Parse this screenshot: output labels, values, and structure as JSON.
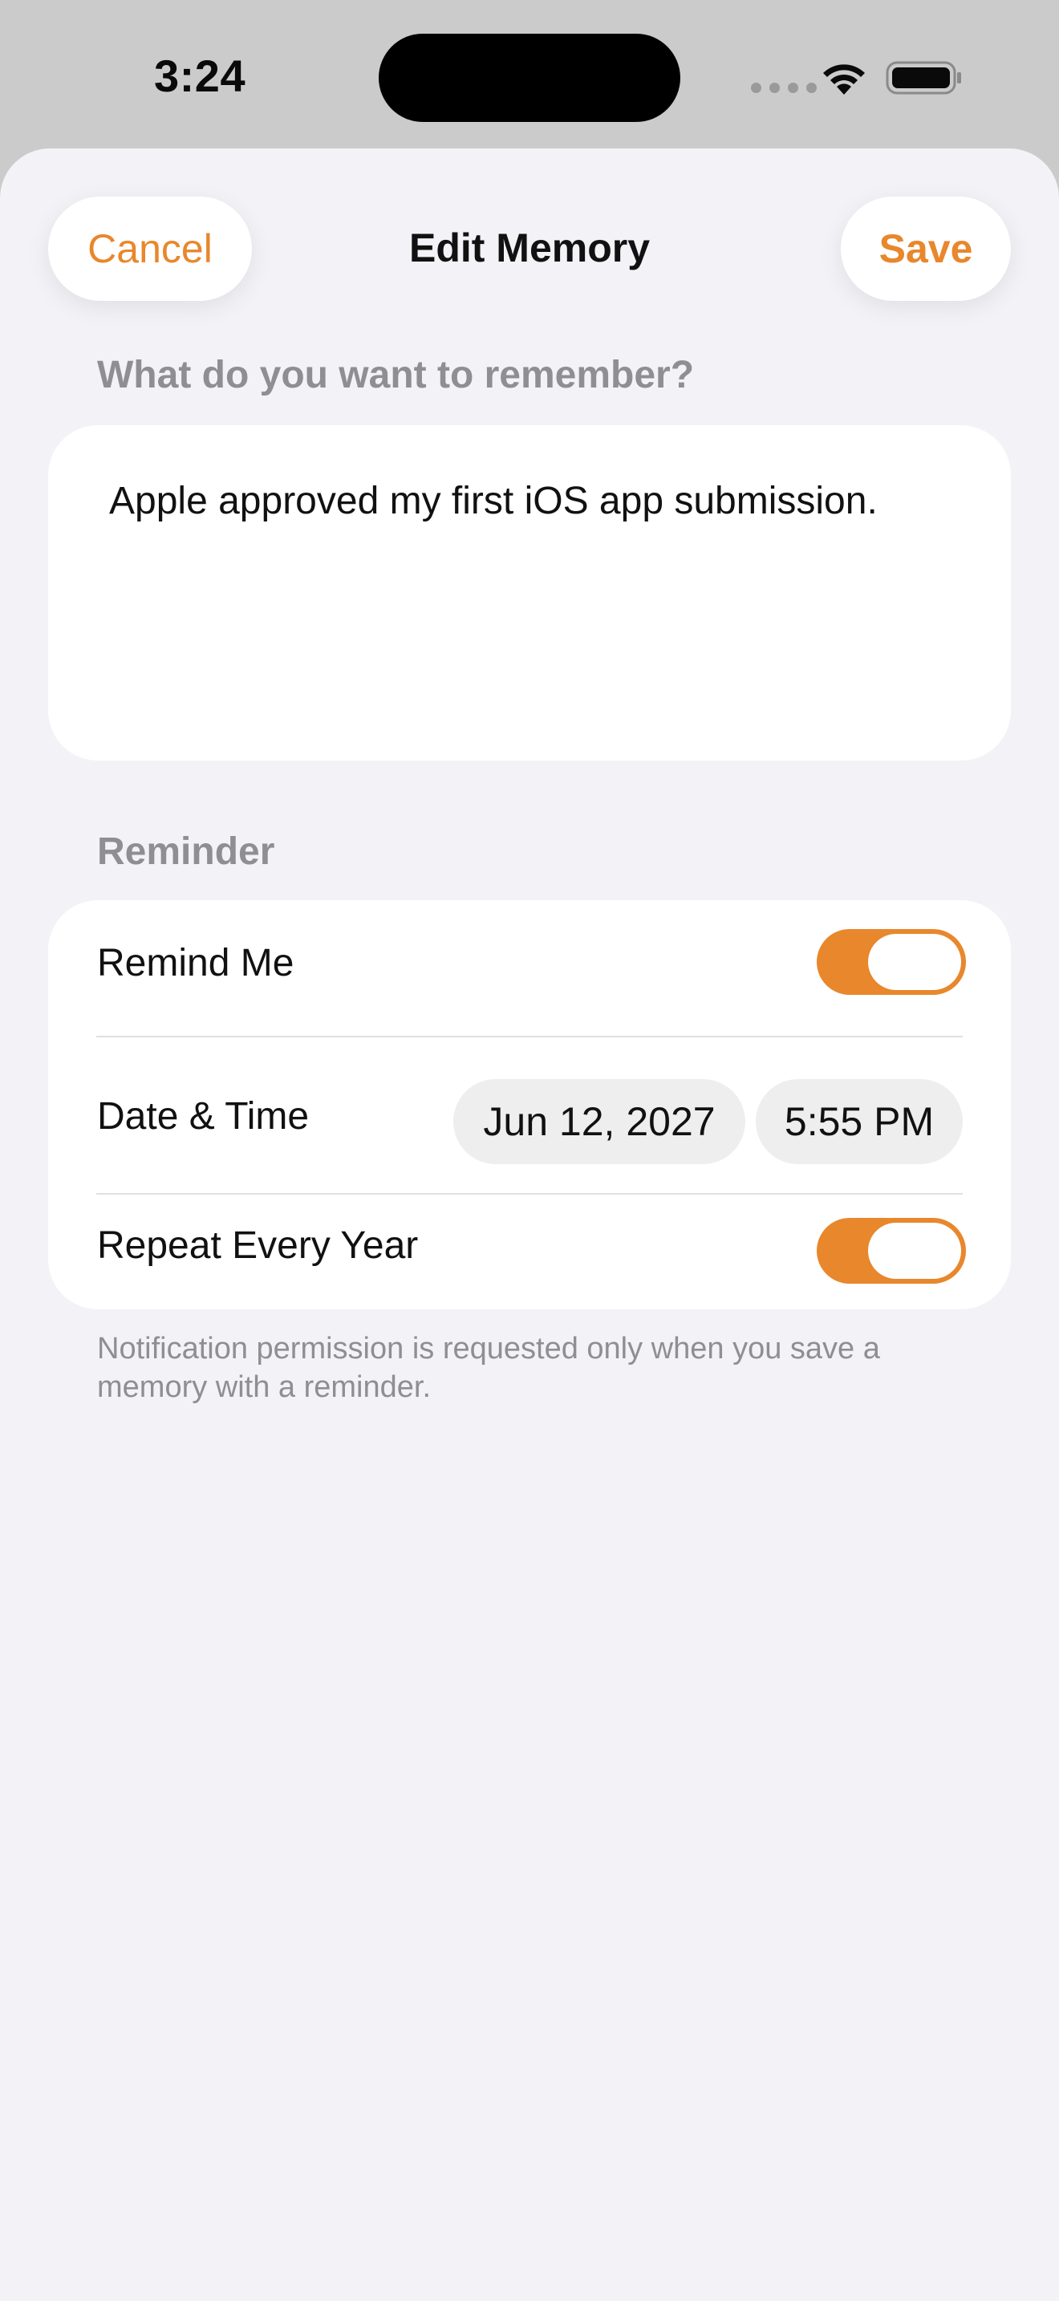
{
  "status_bar": {
    "time": "3:24",
    "icons": [
      "cellular-dots-icon",
      "wifi-icon",
      "battery-icon"
    ]
  },
  "nav": {
    "cancel_label": "Cancel",
    "title": "Edit Memory",
    "save_label": "Save"
  },
  "memory": {
    "section_label": "What do you want to remember?",
    "text": "Apple approved my first iOS app submission."
  },
  "reminder": {
    "section_label": "Reminder",
    "remind_me_label": "Remind Me",
    "remind_me_on": true,
    "date_time_label": "Date & Time",
    "date": "Jun 12, 2027",
    "time": "5:55 PM",
    "repeat_label": "Repeat Every Year",
    "repeat_on": true
  },
  "footer_note": "Notification permission is requested only when you save a memory with a reminder.",
  "colors": {
    "accent": "#e8872c",
    "sheet_background": "#f2f2f7",
    "card_background": "#ffffff",
    "secondary_text": "#8e8e93",
    "chip_background": "#eeeeef"
  }
}
